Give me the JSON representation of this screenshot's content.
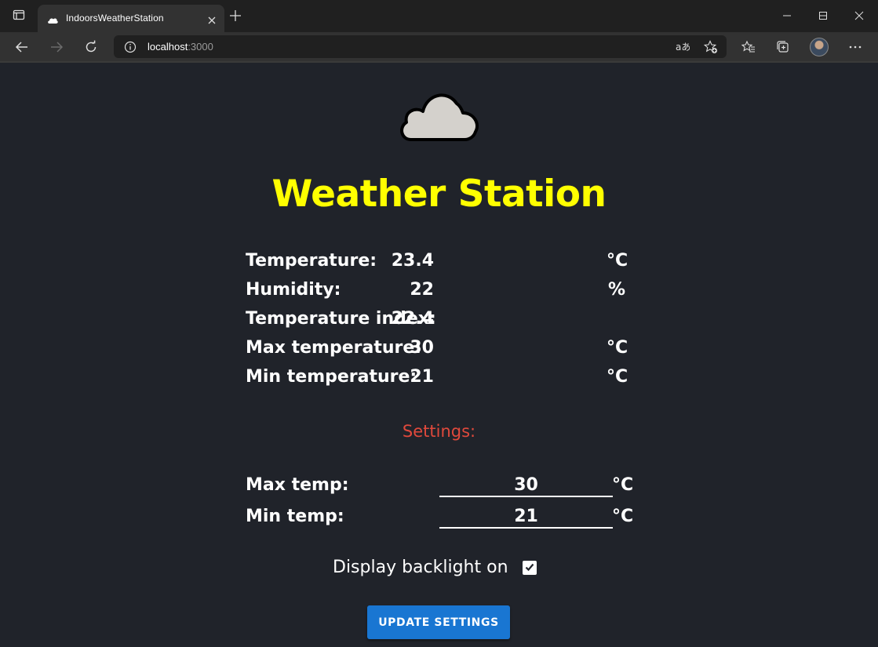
{
  "browser": {
    "tab_title": "IndoorsWeatherStation",
    "url_host": "localhost",
    "url_port": ":3000"
  },
  "page": {
    "title": "Weather Station",
    "readings": [
      {
        "label": "Temperature:",
        "value": "23.4",
        "unit": "°C"
      },
      {
        "label": "Humidity:",
        "value": "22",
        "unit": "%"
      },
      {
        "label": "Temperature index:",
        "value": "22.4",
        "unit": ""
      },
      {
        "label": "Max temperature:",
        "value": "30",
        "unit": "°C"
      },
      {
        "label": "Min temperature:",
        "value": "21",
        "unit": "°C"
      }
    ],
    "settings": {
      "heading": "Settings:",
      "max_temp": {
        "label": "Max temp:",
        "value": "30",
        "unit": "°C"
      },
      "min_temp": {
        "label": "Min temp:",
        "value": "21",
        "unit": "°C"
      },
      "backlight": {
        "label": "Display backlight on",
        "checked": true
      },
      "update_button": "UPDATE SETTINGS"
    }
  },
  "colors": {
    "title": "#ffff00",
    "settings_heading": "#e0493c",
    "button": "#1976d2",
    "page_bg": "#20232a"
  },
  "icons": [
    "sidebar-icon",
    "cloud-icon",
    "close-icon",
    "plus-icon",
    "minimize-icon",
    "maximize-icon",
    "back-icon",
    "forward-icon",
    "refresh-icon",
    "info-icon",
    "read-aloud-icon",
    "add-favorite-icon",
    "favorites-icon",
    "collections-icon",
    "more-icon",
    "check-icon"
  ]
}
